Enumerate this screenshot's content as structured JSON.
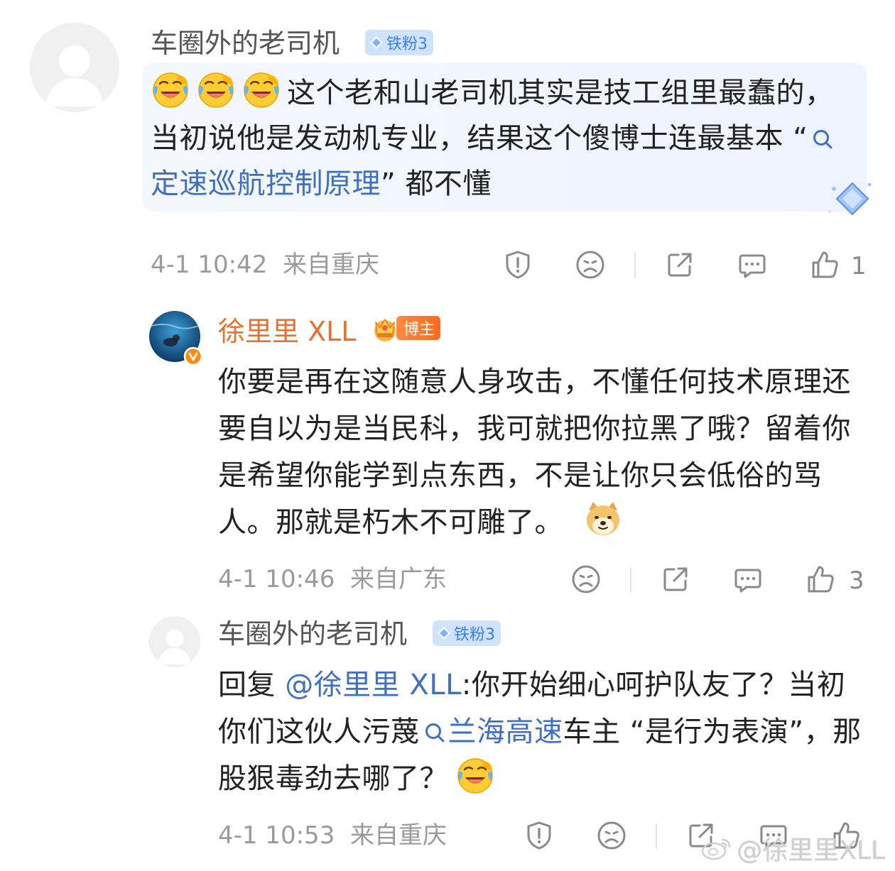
{
  "comments": [
    {
      "username": "车圈外的老司机",
      "fan_badge": "铁粉3",
      "text_prefix": "这个老和山老司机其实是技工组里最蠢的，当初说他是发动机专业，结果这个傻博士连最基本 “",
      "topic_link": "定速巡航控制原理",
      "text_suffix": "” 都不懂",
      "time": "4-1 10:42",
      "location": "来自重庆",
      "likes": "1"
    },
    {
      "username": "徐里里 XLL",
      "role_badge": "博主",
      "text": "你要是再在这随意人身攻击，不懂任何技术原理还要自以为是当民科，我可就把你拉黑了哦？留着你是希望你能学到点东西，不是让你只会低俗的骂人。那就是朽木不可雕了。",
      "time": "4-1 10:46",
      "location": "来自广东",
      "likes": "3"
    },
    {
      "username": "车圈外的老司机",
      "fan_badge": "铁粉3",
      "reply_prefix": "回复 ",
      "mention": "@徐里里 XLL",
      "text_a": ":你开始细心呵护队友了？当初你们这伙人污蔑",
      "topic_link": "兰海高速",
      "text_b": "车主 “是行为表演”，那股狠毒劲去哪了？",
      "time": "4-1 10:53",
      "location": "来自重庆"
    }
  ],
  "watermark": "@徐里里XLL",
  "colors": {
    "link": "#3e6fc5",
    "blogger_name": "#e8702a",
    "meta": "#9a9a9a",
    "fan_badge_bg": "#cfe3ff",
    "fan_badge_text": "#3b7ff0"
  },
  "icons": [
    "report-icon",
    "dislike-face-icon",
    "share-icon",
    "reply-icon",
    "like-icon",
    "laugh-cry-emoji",
    "doge-emoji",
    "diamond-sticker",
    "search-icon",
    "weibo-logo-icon"
  ]
}
